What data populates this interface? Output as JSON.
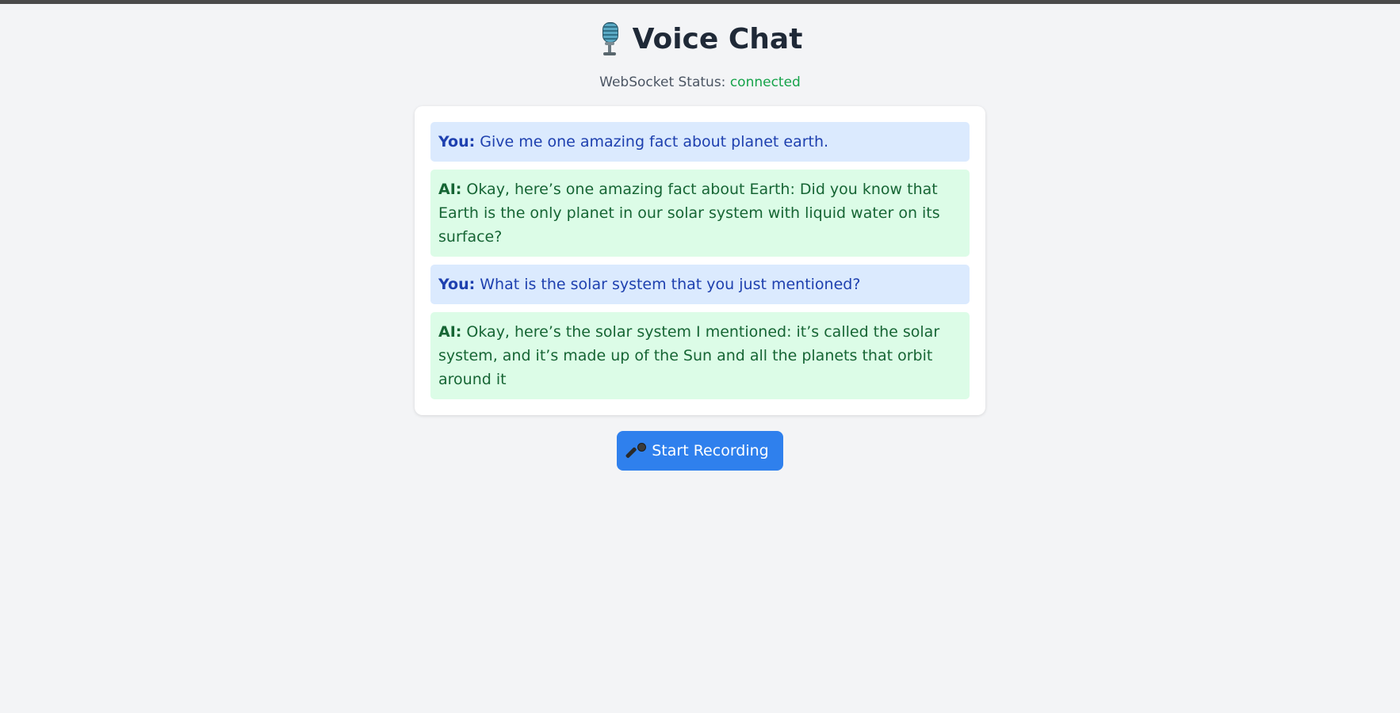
{
  "app": {
    "title": "Voice Chat",
    "title_icon": "studio-microphone-icon"
  },
  "status": {
    "label": "WebSocket Status:",
    "value": "connected",
    "value_color": "#16a34a"
  },
  "messages": [
    {
      "role": "user",
      "speaker": "You:",
      "text": "Give me one amazing fact about planet earth."
    },
    {
      "role": "ai",
      "speaker": "AI:",
      "text": "Okay, here’s one amazing fact about Earth: Did you know that Earth is the only planet in our solar system with liquid water on its surface?"
    },
    {
      "role": "user",
      "speaker": "You:",
      "text": "What is the solar system that you just mentioned?"
    },
    {
      "role": "ai",
      "speaker": "AI:",
      "text": "Okay, here’s the solar system I mentioned: it’s called the solar system, and it’s made up of the Sun and all the planets that orbit around it"
    }
  ],
  "controls": {
    "record_label": "Start Recording",
    "record_icon": "microphone-icon"
  },
  "colors": {
    "user_bubble": "#dbeafe",
    "user_text": "#1e40af",
    "ai_bubble": "#dcfce7",
    "ai_text": "#166534",
    "button": "#2f80ed"
  }
}
